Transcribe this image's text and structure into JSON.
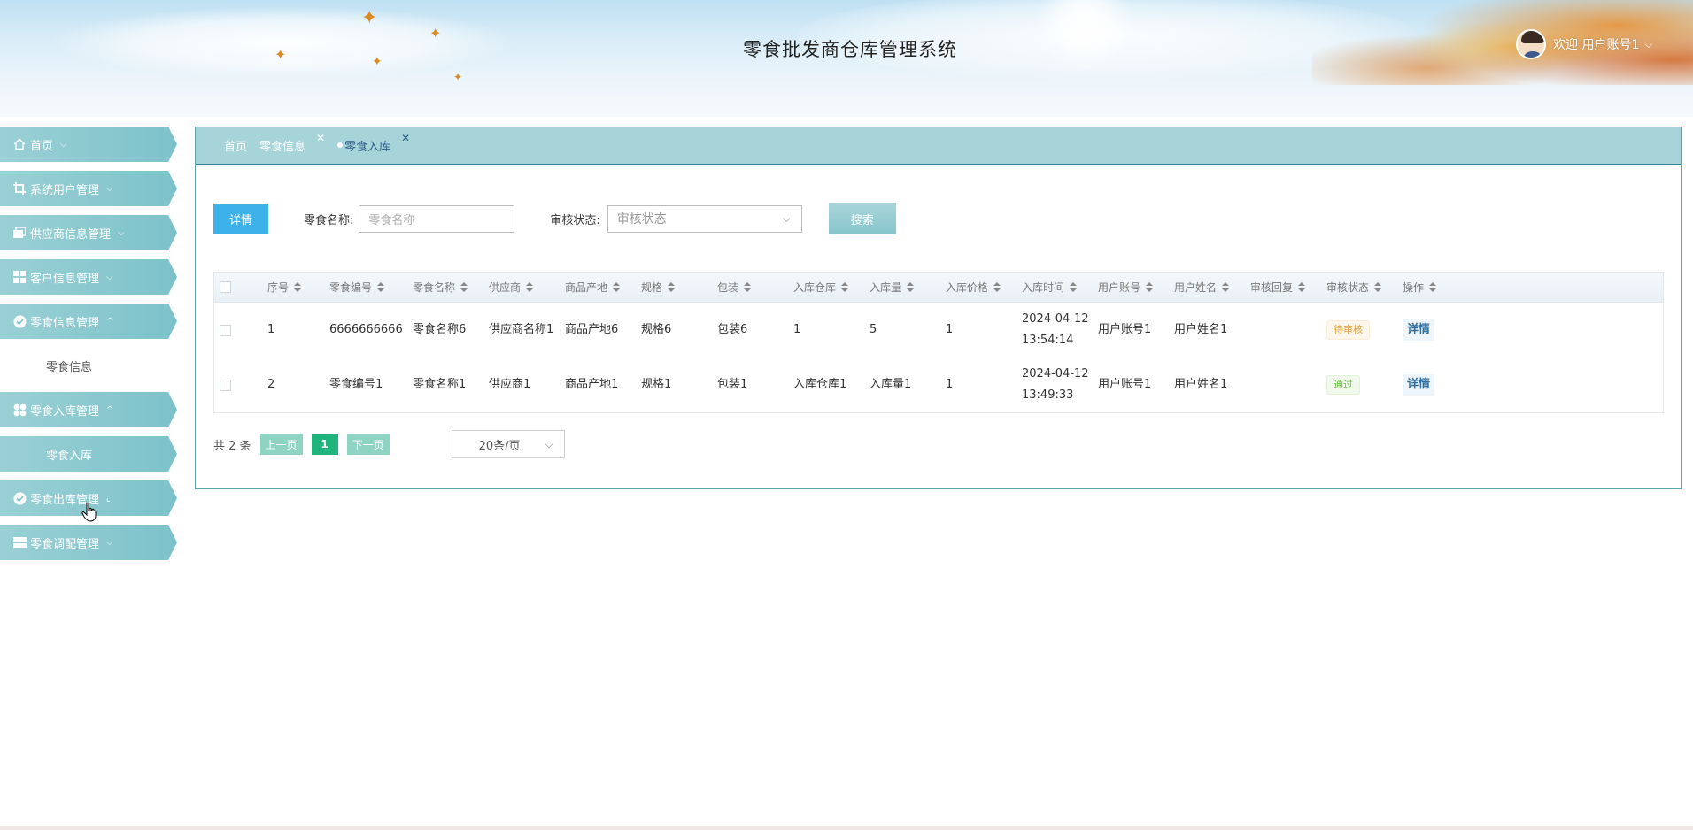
{
  "header": {
    "title": "零食批发商仓库管理系统",
    "user_text": "欢迎 用户账号1"
  },
  "sidebar": {
    "items": [
      {
        "label": "首页",
        "icon": "home-icon"
      },
      {
        "label": "系统用户管理",
        "icon": "crop-icon"
      },
      {
        "label": "供应商信息管理",
        "icon": "cards-icon"
      },
      {
        "label": "客户信息管理",
        "icon": "grid-icon"
      },
      {
        "label": "零食信息管理",
        "icon": "check-circle-icon"
      },
      {
        "label": "零食信息"
      },
      {
        "label": "零食入库管理",
        "icon": "clover-icon"
      },
      {
        "label": "零食入库"
      },
      {
        "label": "零食出库管理",
        "icon": "check-circle-icon"
      },
      {
        "label": "零食调配管理",
        "icon": "list-icon"
      }
    ]
  },
  "tabs": [
    {
      "label": "首页"
    },
    {
      "label": "零食信息"
    },
    {
      "label": "零食入库"
    }
  ],
  "toolbar": {
    "detail_label": "详情",
    "name_label": "零食名称:",
    "name_placeholder": "零食名称",
    "status_label": "审核状态:",
    "status_placeholder": "审核状态",
    "search_label": "搜索"
  },
  "table": {
    "columns": [
      "序号",
      "零食编号",
      "零食名称",
      "供应商",
      "商品产地",
      "规格",
      "包装",
      "入库仓库",
      "入库量",
      "入库价格",
      "入库时间",
      "用户账号",
      "用户姓名",
      "审核回复",
      "审核状态",
      "操作"
    ],
    "rows": [
      {
        "no": "1",
        "code": "6666666666",
        "name": "零食名称6",
        "supplier": "供应商名称1",
        "origin": "商品产地6",
        "spec": "规格6",
        "pack": "包装6",
        "warehouse": "1",
        "qty": "5",
        "price": "1",
        "time_date": "2024-04-12",
        "time_clock": "13:54:14",
        "account": "用户账号1",
        "username": "用户姓名1",
        "reply": "",
        "status": "待审核",
        "action": "详情"
      },
      {
        "no": "2",
        "code": "零食编号1",
        "name": "零食名称1",
        "supplier": "供应商1",
        "origin": "商品产地1",
        "spec": "规格1",
        "pack": "包装1",
        "warehouse": "入库仓库1",
        "qty": "入库量1",
        "price": "1",
        "time_date": "2024-04-12",
        "time_clock": "13:49:33",
        "account": "用户账号1",
        "username": "用户姓名1",
        "reply": "",
        "status": "通过",
        "action": "详情"
      }
    ]
  },
  "pagination": {
    "total": "共 2 条",
    "prev": "上一页",
    "page": "1",
    "next": "下一页",
    "page_size": "20条/页"
  }
}
